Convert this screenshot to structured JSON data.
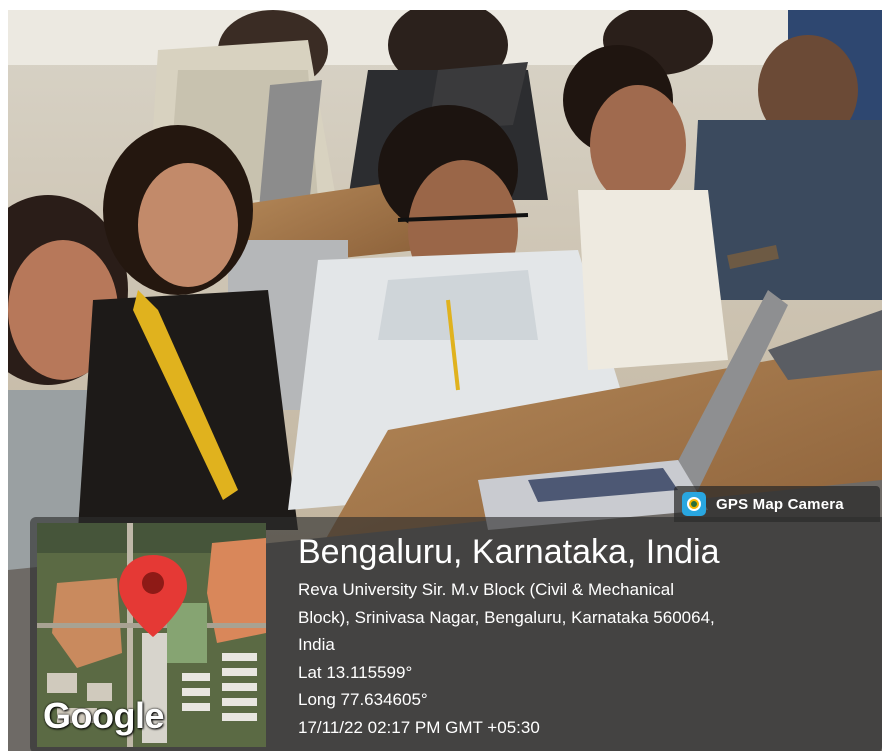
{
  "app": {
    "name": "GPS Map Camera",
    "icon": "gps-map-camera-icon"
  },
  "location": {
    "title": "Bengaluru, Karnataka, India",
    "address_lines": [
      "Reva University Sir. M.v Block (Civil & Mechanical",
      "Block), Srinivasa Nagar, Bengaluru, Karnataka 560064,",
      "India"
    ],
    "lat": "Lat 13.115599°",
    "long": "Long 77.634605°",
    "timestamp": "17/11/22 02:17 PM GMT +05:30"
  },
  "map": {
    "brand": "Google",
    "pin_color": "#e53935"
  },
  "colors": {
    "overlay": "#2d2d2d",
    "accent_pin": "#e53935"
  }
}
